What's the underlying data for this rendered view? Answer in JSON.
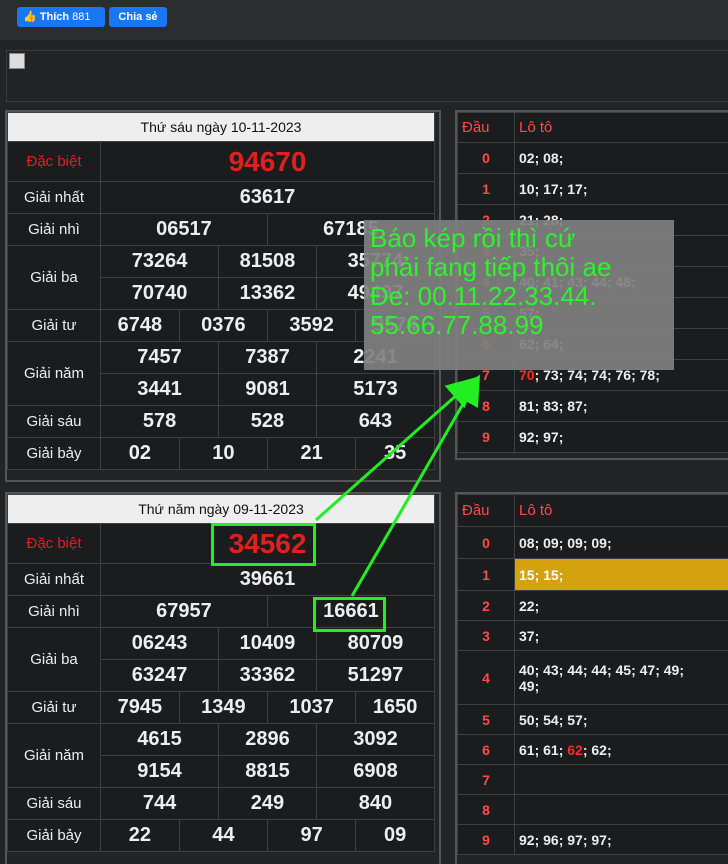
{
  "facebook": {
    "like_label": "Thích",
    "like_count": "881",
    "share_label": "Chia sẻ"
  },
  "colors": {
    "special": "#e02020",
    "highlight": "#d4a20e",
    "annotation": "#22ee22"
  },
  "draw1": {
    "date": "Thứ sáu ngày 10-11-2023",
    "labels": {
      "db": "Đặc biệt",
      "g1": "Giải nhất",
      "g2": "Giải nhì",
      "g3": "Giải ba",
      "g4": "Giải tư",
      "g5": "Giải năm",
      "g6": "Giải sáu",
      "g7": "Giải bảy"
    },
    "special": "94670",
    "g1": "63617",
    "g2": [
      "06517",
      "67185"
    ],
    "g3": [
      "73264",
      "81508",
      "35774",
      "70740",
      "13362",
      "49497"
    ],
    "g4": [
      "6748",
      "0376",
      "3592",
      "9574"
    ],
    "g5": [
      "7457",
      "7387",
      "2241",
      "3441",
      "9081",
      "5173"
    ],
    "g6": [
      "578",
      "528",
      "643"
    ],
    "g7": [
      "02",
      "10",
      "21",
      "35"
    ]
  },
  "loto1": {
    "head_dau": "Đầu",
    "head_loto": "Lô tô",
    "rows": [
      {
        "d": "0",
        "v": "02; 08;"
      },
      {
        "d": "1",
        "v": "10; 17; 17;"
      },
      {
        "d": "2",
        "v": "21; 28;"
      },
      {
        "d": "3",
        "v": "35;"
      },
      {
        "d": "4",
        "v": "40; 41; 43; 44; 48;"
      },
      {
        "d": "5",
        "v": "57;"
      },
      {
        "d": "6",
        "v": "62; 64;"
      },
      {
        "d": "7",
        "red": "70",
        "v": "; 73; 74; 74; 76; 78;"
      },
      {
        "d": "8",
        "v": "81; 83; 87;"
      },
      {
        "d": "9",
        "v": "92; 97;"
      }
    ]
  },
  "draw2": {
    "date": "Thứ năm ngày 09-11-2023",
    "labels": {
      "db": "Đặc biệt",
      "g1": "Giải nhất",
      "g2": "Giải nhì",
      "g3": "Giải ba",
      "g4": "Giải tư",
      "g5": "Giải năm",
      "g6": "Giải sáu",
      "g7": "Giải bảy"
    },
    "special": "34562",
    "g1": "39661",
    "g2": [
      "67957",
      "16661"
    ],
    "g3": [
      "06243",
      "10409",
      "80709",
      "63247",
      "33362",
      "51297"
    ],
    "g4": [
      "7945",
      "1349",
      "1037",
      "1650"
    ],
    "g5": [
      "4615",
      "2896",
      "3092",
      "9154",
      "8815",
      "6908"
    ],
    "g6": [
      "744",
      "249",
      "840"
    ],
    "g7": [
      "22",
      "44",
      "97",
      "09"
    ]
  },
  "loto2": {
    "head_dau": "Đầu",
    "head_loto": "Lô tô",
    "rows": [
      {
        "d": "0",
        "v": "08; 09; 09; 09;"
      },
      {
        "d": "1",
        "v": "15; 15;"
      },
      {
        "d": "2",
        "v": "22;"
      },
      {
        "d": "3",
        "v": "37;"
      },
      {
        "d": "4",
        "v": "40; 43; 44; 44; 45; 47; 49;",
        "v2": "49;"
      },
      {
        "d": "5",
        "v": "50; 54; 57;"
      },
      {
        "d": "6",
        "v": "61; 61; ",
        "red": "62",
        "v3": "; 62;"
      },
      {
        "d": "7",
        "v": ""
      },
      {
        "d": "8",
        "v": ""
      },
      {
        "d": "9",
        "v": "92; 96; 97; 97;"
      }
    ]
  },
  "annotation": {
    "lines": [
      "Báo kép rồi thì cứ",
      "phải fang tiếp thôi ae",
      "Đe: 00.11.22.33.44.",
      "55.66.77.88.99"
    ]
  }
}
